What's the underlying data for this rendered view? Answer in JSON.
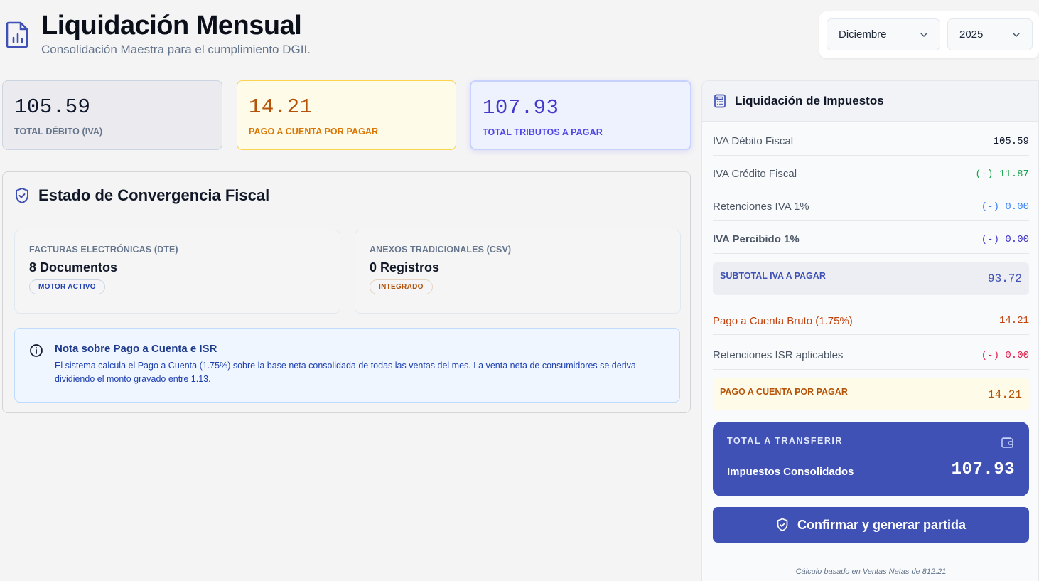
{
  "header": {
    "title": "Liquidación Mensual",
    "subtitle": "Consolidación Maestra para el cumplimiento DGII."
  },
  "period": {
    "month": "Diciembre",
    "year": "2025"
  },
  "kpis": [
    {
      "value": "105.59",
      "label": "TOTAL DÉBITO (IVA)"
    },
    {
      "value": "14.21",
      "label": "PAGO A CUENTA POR PAGAR"
    },
    {
      "value": "107.93",
      "label": "TOTAL TRIBUTOS A PAGAR"
    }
  ],
  "convergence": {
    "title": "Estado de Convergencia Fiscal",
    "dte": {
      "label": "FACTURAS ELECTRÓNICAS (DTE)",
      "value": "8 Documentos",
      "badge": "MOTOR ACTIVO"
    },
    "csv": {
      "label": "ANEXOS TRADICIONALES (CSV)",
      "value": "0 Registros",
      "badge": "INTEGRADO"
    },
    "note": {
      "title": "Nota sobre Pago a Cuenta e ISR",
      "body": "El sistema calcula el Pago a Cuenta (1.75%) sobre la base neta consolidada de todas las ventas del mes. La venta neta de consumidores se deriva dividiendo el monto gravado entre 1.13."
    }
  },
  "liquidacion": {
    "title": "Liquidación de Impuestos",
    "rows": [
      {
        "label": "IVA Débito Fiscal",
        "value": "105.59"
      },
      {
        "label": "IVA Crédito Fiscal",
        "value": "(-) 11.87"
      },
      {
        "label": "Retenciones IVA 1%",
        "value": "(-) 0.00"
      },
      {
        "label": "IVA Percibido 1%",
        "value": "(-) 0.00"
      }
    ],
    "subtotal_iva": {
      "label": "SUBTOTAL IVA A PAGAR",
      "value": "93.72"
    },
    "rows2": [
      {
        "label": "Pago a Cuenta Bruto (1.75%)",
        "value": "14.21"
      },
      {
        "label": "Retenciones ISR aplicables",
        "value": "(-) 0.00"
      }
    ],
    "subtotal_pago": {
      "label": "PAGO A CUENTA POR PAGAR",
      "value": "14.21"
    },
    "transfer": {
      "label": "TOTAL A TRANSFERIR",
      "sublabel": "Impuestos Consolidados",
      "value": "107.93"
    },
    "confirm_label": "Confirmar y generar partida",
    "footnote": "Cálculo basado en Ventas Netas de 812.21"
  },
  "colors": {
    "accent": "#3f51b5",
    "green": "#16a34a",
    "blue": "#3b82f6",
    "orange": "#c2410c",
    "red": "#e11d48"
  }
}
